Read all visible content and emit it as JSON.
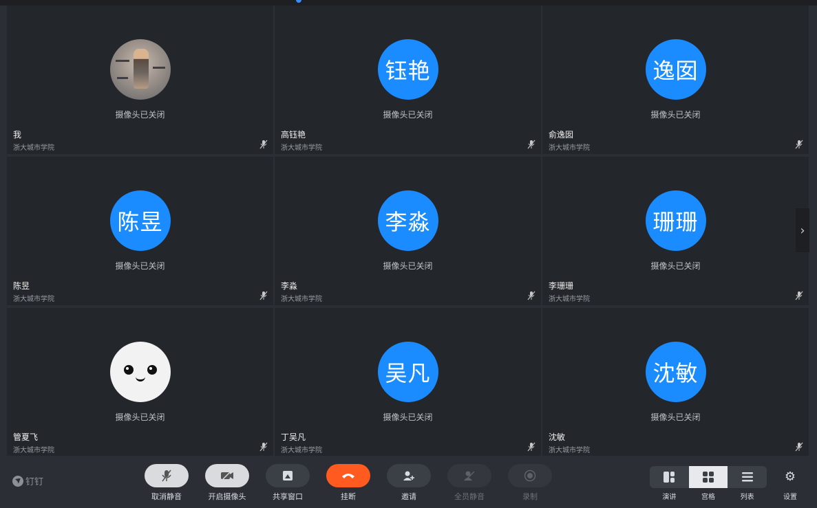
{
  "participants": [
    {
      "name": "我",
      "org": "浙大城市学院",
      "camera_status": "摄像头已关闭",
      "avatar_text": "",
      "avatar_type": "photo"
    },
    {
      "name": "高钰艳",
      "org": "浙大城市学院",
      "camera_status": "摄像头已关闭",
      "avatar_text": "钰艳",
      "avatar_type": "initials"
    },
    {
      "name": "俞逸囡",
      "org": "浙大城市学院",
      "camera_status": "摄像头已关闭",
      "avatar_text": "逸囡",
      "avatar_type": "initials"
    },
    {
      "name": "陈昱",
      "org": "浙大城市学院",
      "camera_status": "摄像头已关闭",
      "avatar_text": "陈昱",
      "avatar_type": "initials"
    },
    {
      "name": "李淼",
      "org": "浙大城市学院",
      "camera_status": "摄像头已关闭",
      "avatar_text": "李淼",
      "avatar_type": "initials"
    },
    {
      "name": "李珊珊",
      "org": "浙大城市学院",
      "camera_status": "摄像头已关闭",
      "avatar_text": "珊珊",
      "avatar_type": "initials"
    },
    {
      "name": "管夏飞",
      "org": "浙大城市学院",
      "camera_status": "摄像头已关闭",
      "avatar_text": "",
      "avatar_type": "face"
    },
    {
      "name": "丁吴凡",
      "org": "浙大城市学院",
      "camera_status": "摄像头已关闭",
      "avatar_text": "吴凡",
      "avatar_type": "initials"
    },
    {
      "name": "沈敏",
      "org": "浙大城市学院",
      "camera_status": "摄像头已关闭",
      "avatar_text": "沈敏",
      "avatar_type": "initials"
    }
  ],
  "brand": {
    "name": "钉钉"
  },
  "controls": {
    "unmute": "取消静音",
    "camera_on": "开启摄像头",
    "share_window": "共享窗口",
    "hang_up": "挂断",
    "invite": "邀请",
    "mute_all": "全员静音",
    "record": "录制"
  },
  "views": {
    "speaker": "演讲",
    "grid": "宫格",
    "list": "列表",
    "active": "grid"
  },
  "settings_label": "设置",
  "colors": {
    "avatar_blue": "#1a8cff",
    "hangup_red": "#ff5a1f",
    "tile_bg": "#23262b",
    "bar_bg": "#2b2e34"
  }
}
